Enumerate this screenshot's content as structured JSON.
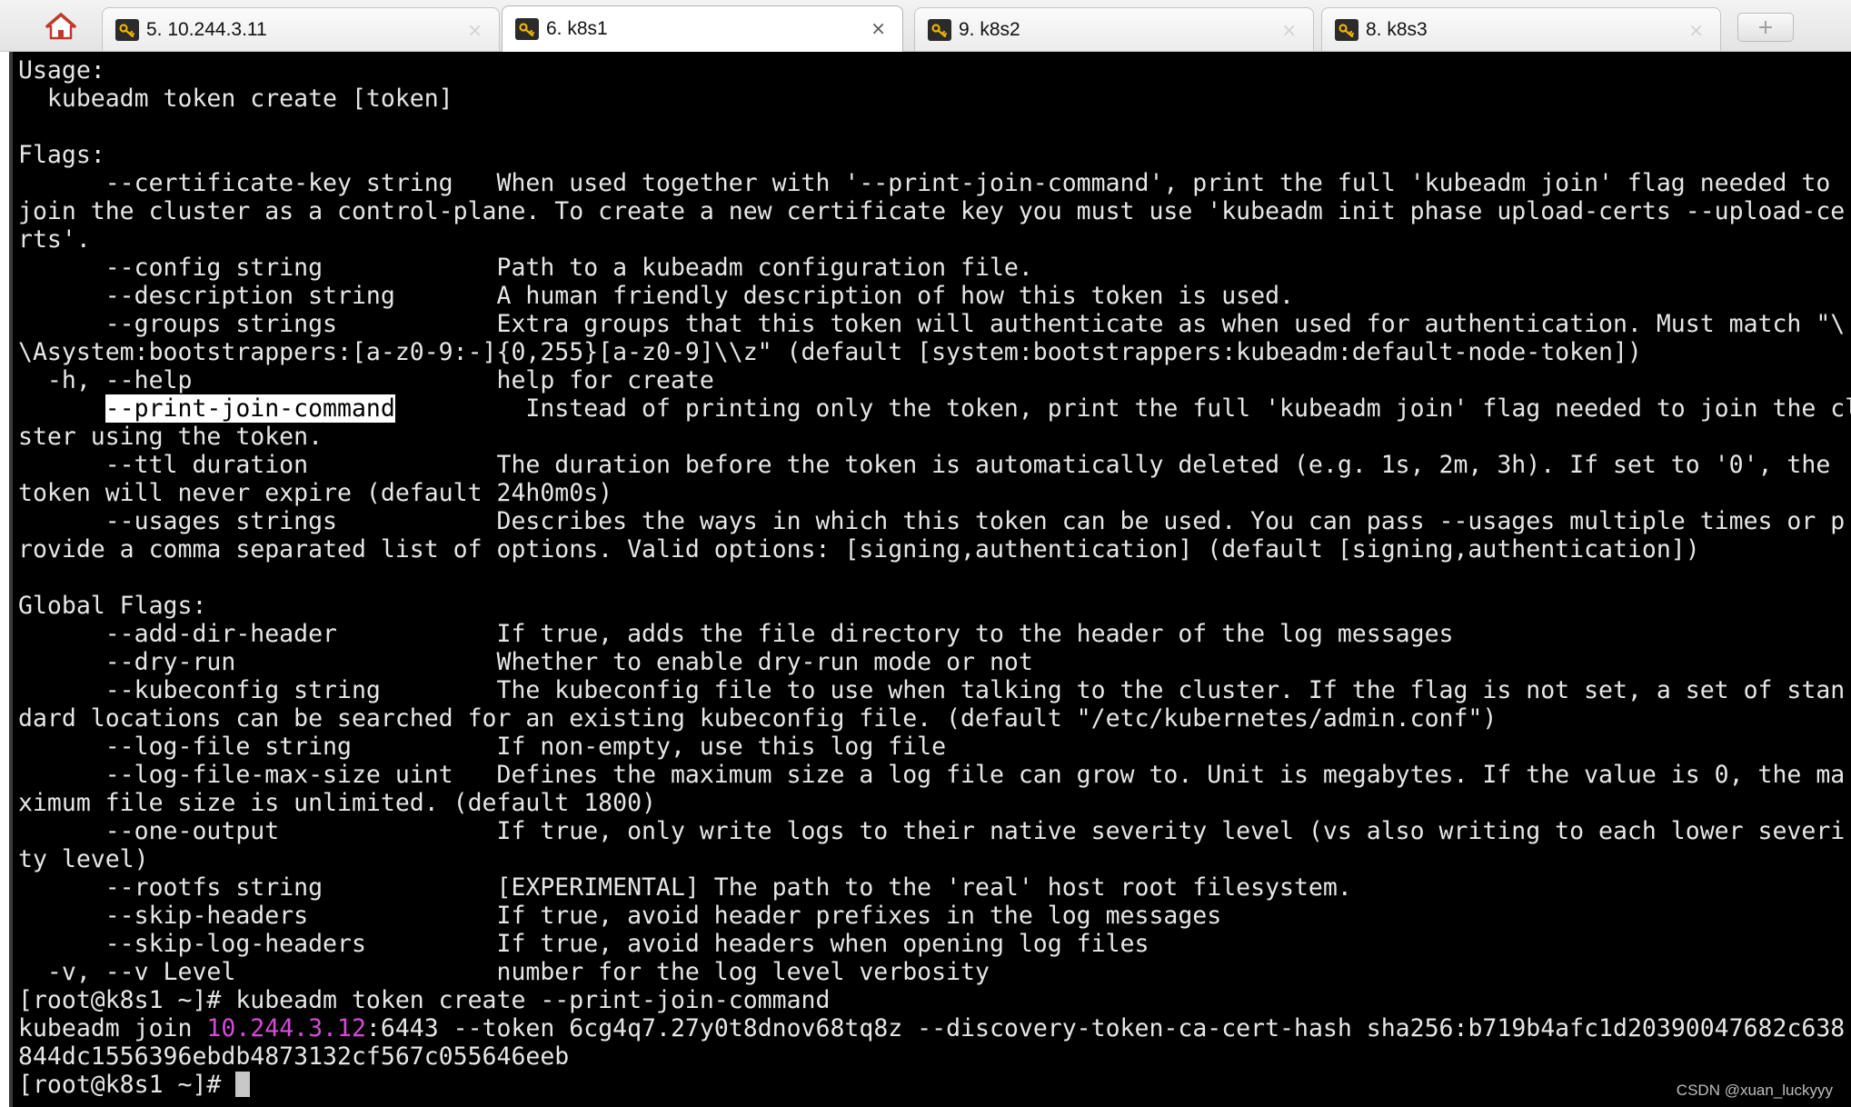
{
  "colors": {
    "terminal_background": "#000000",
    "terminal_foreground": "#e6e6e6",
    "ip_highlight": "#d64bd6",
    "selection_background": "#ffffff",
    "selection_foreground": "#000000"
  },
  "tabs": {
    "home_icon": "house-icon",
    "tab_icon": "key-icon",
    "close_glyph": "×",
    "new_tab_glyph": "+",
    "items": [
      {
        "label": "5. 10.244.3.11",
        "active": false
      },
      {
        "label": "6. k8s1",
        "active": true
      },
      {
        "label": "9. k8s2",
        "active": false
      },
      {
        "label": "8. k8s3",
        "active": false
      }
    ]
  },
  "terminal": {
    "line01": "Usage:",
    "line02": "  kubeadm token create [token]",
    "line03": "",
    "line04": "Flags:",
    "line05": "      --certificate-key string   When used together with '--print-join-command', print the full 'kubeadm join' flag needed to",
    "line06": "join the cluster as a control-plane. To create a new certificate key you must use 'kubeadm init phase upload-certs --upload-ce",
    "line07": "rts'.",
    "line08": "      --config string            Path to a kubeadm configuration file.",
    "line09": "      --description string       A human friendly description of how this token is used.",
    "line10": "      --groups strings           Extra groups that this token will authenticate as when used for authentication. Must match \"\\",
    "line11": "\\Asystem:bootstrappers:[a-z0-9:-]{0,255}[a-z0-9]\\\\z\" (default [system:bootstrappers:kubeadm:default-node-token])",
    "line12": "  -h, --help                     help for create",
    "line13_indent": "      ",
    "line13_selected": "--print-join-command",
    "line13_rest": "         Instead of printing only the token, print the full 'kubeadm join' flag needed to join the clu",
    "line14": "ster using the token.",
    "line15": "      --ttl duration             The duration before the token is automatically deleted (e.g. 1s, 2m, 3h). If set to '0', the",
    "line16": "token will never expire (default 24h0m0s)",
    "line17": "      --usages strings           Describes the ways in which this token can be used. You can pass --usages multiple times or p",
    "line18": "rovide a comma separated list of options. Valid options: [signing,authentication] (default [signing,authentication])",
    "line19": "",
    "line20": "Global Flags:",
    "line21": "      --add-dir-header           If true, adds the file directory to the header of the log messages",
    "line22": "      --dry-run                  Whether to enable dry-run mode or not",
    "line23": "      --kubeconfig string        The kubeconfig file to use when talking to the cluster. If the flag is not set, a set of stan",
    "line24": "dard locations can be searched for an existing kubeconfig file. (default \"/etc/kubernetes/admin.conf\")",
    "line25": "      --log-file string          If non-empty, use this log file",
    "line26": "      --log-file-max-size uint   Defines the maximum size a log file can grow to. Unit is megabytes. If the value is 0, the ma",
    "line27": "ximum file size is unlimited. (default 1800)",
    "line28": "      --one-output               If true, only write logs to their native severity level (vs also writing to each lower severi",
    "line29": "ty level)",
    "line30": "      --rootfs string            [EXPERIMENTAL] The path to the 'real' host root filesystem.",
    "line31": "      --skip-headers             If true, avoid header prefixes in the log messages",
    "line32": "      --skip-log-headers         If true, avoid headers when opening log files",
    "line33": "  -v, --v Level                  number for the log level verbosity",
    "line34": "[root@k8s1 ~]# kubeadm token create --print-join-command",
    "line35_prefix": "kubeadm join ",
    "line35_ip": "10.244.3.12",
    "line35_rest": ":6443 --token 6cg4q7.27y0t8dnov68tq8z --discovery-token-ca-cert-hash sha256:b719b4afc1d20390047682c638",
    "line36": "844dc1556396ebdb4873132cf567c055646eeb",
    "line37_prompt": "[root@k8s1 ~]# "
  },
  "watermark": "CSDN @xuan_luckyyy"
}
